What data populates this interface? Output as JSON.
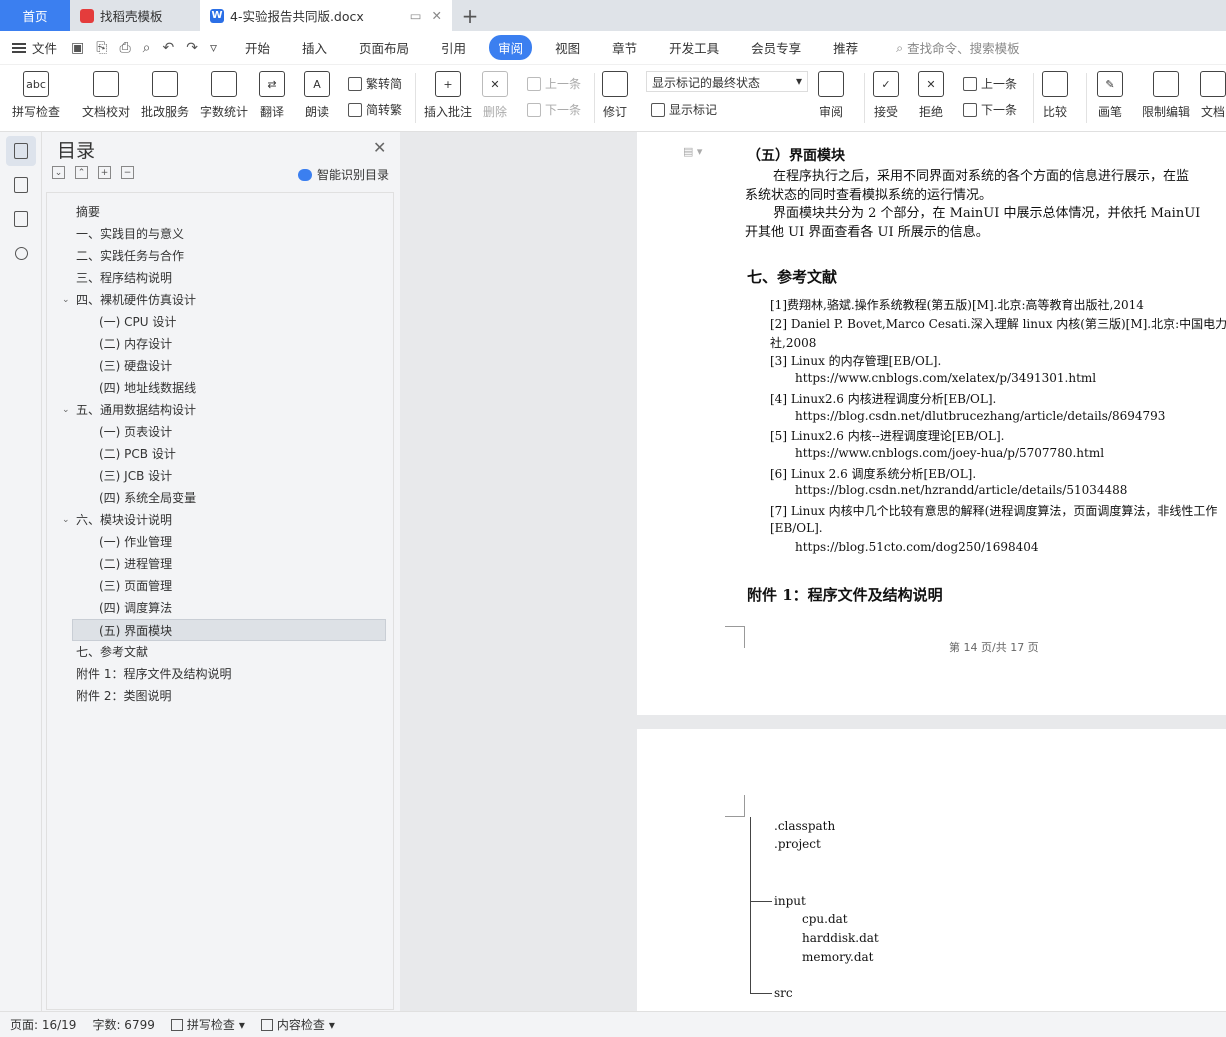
{
  "tabs": {
    "home": "首页",
    "template": "找稻壳模板",
    "document": "4-实验报告共同版.docx"
  },
  "menubar": {
    "file": "文件",
    "items": [
      "开始",
      "插入",
      "页面布局",
      "引用",
      "审阅",
      "视图",
      "章节",
      "开发工具",
      "会员专享",
      "推荐"
    ],
    "active": "审阅",
    "search_placeholder": "查找命令、搜索模板"
  },
  "ribbon": {
    "spell_check": "拼写检查",
    "doc_proof": "文档校对",
    "batch_service": "批改服务",
    "word_count": "字数统计",
    "translate": "翻译",
    "read_aloud": "朗读",
    "trad_to_simp": "繁转简",
    "simp_to_trad": "简转繁",
    "insert_comment": "插入批注",
    "delete": "删除",
    "prev": "上一条",
    "next": "下一条",
    "track": "修订",
    "mark_select": "显示标记的最终状态",
    "show_marks": "显示标记",
    "review": "审阅",
    "accept": "接受",
    "reject": "拒绝",
    "prev2": "上一条",
    "next2": "下一条",
    "compare": "比较",
    "pen": "画笔",
    "restrict": "限制编辑",
    "doc_more": "文档"
  },
  "toc": {
    "title": "目录",
    "smart": "智能识别目录",
    "items": [
      {
        "label": "摘要",
        "level": 1
      },
      {
        "label": "一、实践目的与意义",
        "level": 1
      },
      {
        "label": "二、实践任务与合作",
        "level": 1
      },
      {
        "label": "三、程序结构说明",
        "level": 1
      },
      {
        "label": "四、裸机硬件仿真设计",
        "level": 1,
        "expanded": true
      },
      {
        "label": "(一) CPU 设计",
        "level": 2
      },
      {
        "label": "(二) 内存设计",
        "level": 2
      },
      {
        "label": "(三) 硬盘设计",
        "level": 2
      },
      {
        "label": "(四) 地址线数据线",
        "level": 2
      },
      {
        "label": "五、通用数据结构设计",
        "level": 1,
        "expanded": true
      },
      {
        "label": "(一) 页表设计",
        "level": 2
      },
      {
        "label": "(二) PCB 设计",
        "level": 2
      },
      {
        "label": "(三) JCB 设计",
        "level": 2
      },
      {
        "label": "(四) 系统全局变量",
        "level": 2
      },
      {
        "label": "六、模块设计说明",
        "level": 1,
        "expanded": true
      },
      {
        "label": "(一) 作业管理",
        "level": 2
      },
      {
        "label": "(二) 进程管理",
        "level": 2
      },
      {
        "label": "(三) 页面管理",
        "level": 2
      },
      {
        "label": "(四) 调度算法",
        "level": 2
      },
      {
        "label": "(五) 界面模块",
        "level": 2,
        "selected": true
      },
      {
        "label": "七、参考文献",
        "level": 1
      },
      {
        "label": "附件 1：程序文件及结构说明",
        "level": 1
      },
      {
        "label": "附件 2：类图说明",
        "level": 1
      }
    ]
  },
  "document": {
    "section5_title": "（五）界面模块",
    "para1_line1": "在程序执行之后，采用不同界面对系统的各个方面的信息进行展示，在监",
    "para1_line2": "系统状态的同时查看模拟系统的运行情况。",
    "para2_line1": "界面模块共分为 2 个部分，在 MainUI 中展示总体情况，并依托 MainUI",
    "para2_line2": "开其他 UI 界面查看各 UI 所展示的信息。",
    "section7_title": "七、参考文献",
    "refs": [
      "[1]费翔林,骆斌.操作系统教程(第五版)[M].北京:高等教育出版社,2014",
      "[2] Daniel P. Bovet,Marco Cesati.深入理解 linux 内核(第三版)[M].北京:中国电力出",
      "社,2008",
      "[3] Linux 的内存管理[EB/OL].",
      "https://www.cnblogs.com/xelatex/p/3491301.html",
      "[4] Linux2.6  内核进程调度分析[EB/OL].",
      "https://blog.csdn.net/dlutbrucezhang/article/details/8694793",
      "[5] Linux2.6 内核--进程调度理论[EB/OL].",
      "https://www.cnblogs.com/joey-hua/p/5707780.html",
      "[6] Linux 2.6  调度系统分析[EB/OL].",
      "https://blog.csdn.net/hzrandd/article/details/51034488",
      "[7] Linux 内核中几个比较有意思的解释(进程调度算法，页面调度算法，非线性工作",
      "[EB/OL].",
      "https://blog.51cto.com/dog250/1698404"
    ],
    "appendix_title": "附件 1：程序文件及结构说明",
    "footer": "第 14 页/共 17 页",
    "tree": [
      ".classpath",
      ".project",
      "input",
      "cpu.dat",
      "harddisk.dat",
      "memory.dat",
      "src"
    ]
  },
  "status": {
    "page": "页面: 16/19",
    "words": "字数: 6799",
    "spell": "拼写检查",
    "content": "内容检查"
  }
}
